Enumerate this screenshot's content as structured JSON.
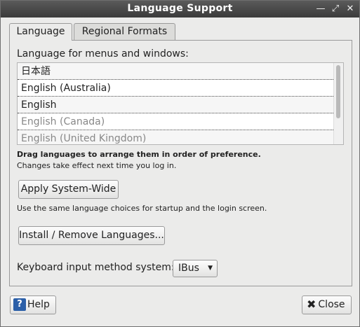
{
  "window": {
    "title": "Language Support"
  },
  "tabs": [
    {
      "label": "Language",
      "active": true
    },
    {
      "label": "Regional Formats",
      "active": false
    }
  ],
  "language": {
    "heading": "Language for menus and windows:",
    "items": [
      "日本語",
      "English (Australia)",
      "English",
      "English (Canada)",
      "English (United Kingdom)"
    ],
    "hint_bold": "Drag languages to arrange them in order of preference.",
    "hint": "Changes take effect next time you log in.",
    "apply_label": "Apply System-Wide",
    "apply_desc": "Use the same language choices for startup and the login screen.",
    "install_label": "Install / Remove Languages...",
    "keyboard_label": "Keyboard input method system:",
    "keyboard_value": "IBus"
  },
  "footer": {
    "help_label": "Help",
    "close_label": "Close"
  }
}
